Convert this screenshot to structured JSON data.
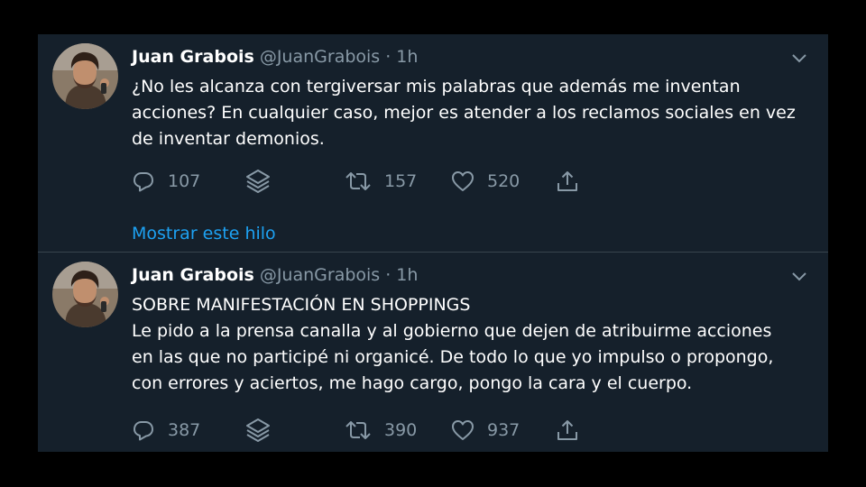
{
  "tweets": [
    {
      "author": {
        "name": "Juan Grabois",
        "handle": "@JuanGrabois"
      },
      "time": "1h",
      "separator": "·",
      "lines": [
        "¿No les alcanza con tergiversar mis palabras que además me inventan",
        "acciones? En cualquier caso, mejor es atender a los reclamos sociales en vez",
        "de inventar demonios."
      ],
      "actions": {
        "replies": "107",
        "retweets": "157",
        "likes": "520"
      },
      "thread_link": "Mostrar este hilo"
    },
    {
      "author": {
        "name": "Juan Grabois",
        "handle": "@JuanGrabois"
      },
      "time": "1h",
      "separator": "·",
      "lines": [
        "SOBRE MANIFESTACIÓN EN SHOPPINGS",
        "Le pido a la prensa canalla y al gobierno que dejen de atribuirme acciones",
        "en las que no participé ni organicé. De todo lo que yo impulso o propongo,",
        "con errores y aciertos, me hago cargo, pongo la cara y el cuerpo."
      ],
      "actions": {
        "replies": "387",
        "retweets": "390",
        "likes": "937"
      }
    }
  ],
  "icons": {
    "reply": "reply-icon",
    "layers": "layers-icon",
    "retweet": "retweet-icon",
    "like": "heart-icon",
    "share": "share-icon",
    "menu": "chevron-down-icon"
  },
  "colors": {
    "background": "#15202b",
    "text": "#ffffff",
    "secondary": "#8899a6",
    "link": "#1da1f2",
    "divider": "#38444d"
  }
}
